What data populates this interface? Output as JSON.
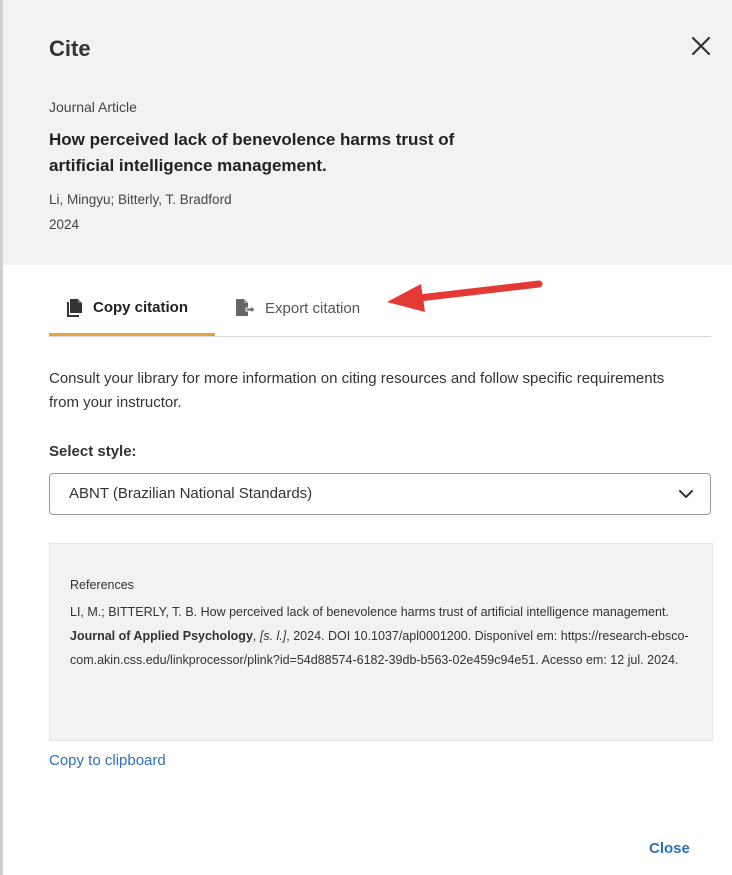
{
  "dialog": {
    "title": "Cite",
    "close_icon": "close-x-icon"
  },
  "record": {
    "type": "Journal Article",
    "title": "How perceived lack of benevolence harms trust of artificial intelligence management.",
    "authors": "Li, Mingyu; Bitterly, T. Bradford",
    "year": "2024"
  },
  "tabs": [
    {
      "label": "Copy citation",
      "icon": "copy-document-icon",
      "active": true
    },
    {
      "label": "Export citation",
      "icon": "export-file-icon",
      "active": false
    }
  ],
  "annotation": {
    "arrow_color": "#e53935",
    "points_to": "Export citation"
  },
  "main": {
    "intro": "Consult your library for more information on citing resources and follow specific requirements from your instructor.",
    "select_label": "Select style:",
    "selected_style": "ABNT (Brazilian National Standards)"
  },
  "reference": {
    "heading": "References",
    "part1": "LI, M.; BITTERLY, T. B. How perceived lack of benevolence harms trust of artificial intelligence management. ",
    "journal": "Journal of Applied Psychology",
    "sep1": ", ",
    "place": "[s. l.]",
    "part2": ", 2024. DOI 10.1037/apl0001200. Disponível em: https://research-ebsco-com.akin.css.edu/linkprocessor/plink?id=54d88574-6182-39db-b563-02e459c94e51. Acesso em: 12 jul. 2024."
  },
  "footer": {
    "copy_link": "Copy to clipboard",
    "close_button": "Close"
  },
  "colors": {
    "accent_tab": "#e8a23a",
    "link": "#2e6fc0",
    "header_bg": "#f2f2f2"
  }
}
